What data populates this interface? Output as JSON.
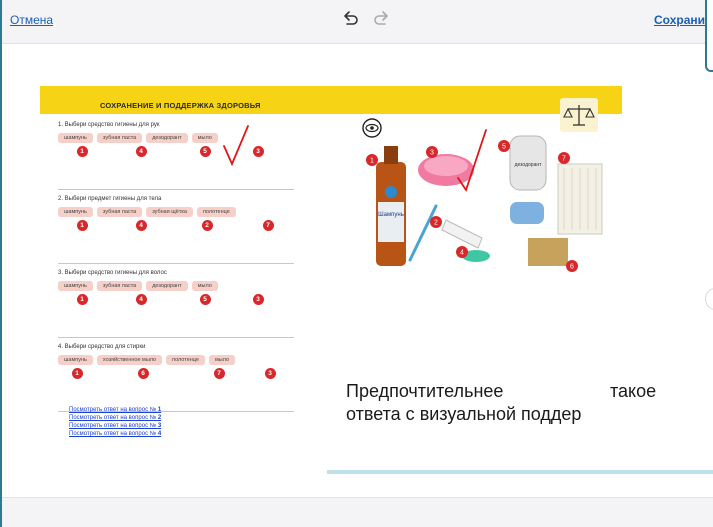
{
  "toolbar": {
    "cancel_label": "Отмена",
    "save_label": "Сохранить"
  },
  "slide": {
    "title": "СОХРАНЕНИЕ И ПОДДЕРЖКА ЗДОРОВЬЯ",
    "questions": [
      {
        "text": "1. Выбери средство гигиены для рук",
        "options": [
          "шампунь",
          "зубная паста",
          "дезодорант",
          "мыло"
        ],
        "numbers": [
          "1",
          "4",
          "5",
          "3"
        ]
      },
      {
        "text": "2. Выбери предмет гигиены для тела",
        "options": [
          "шампунь",
          "зубная паста",
          "зубная щётка",
          "полотенце"
        ],
        "numbers": [
          "1",
          "4",
          "2",
          "7"
        ]
      },
      {
        "text": "3. Выбери средство гигиены для волос",
        "options": [
          "шампунь",
          "зубная паста",
          "дезодорант",
          "мыло"
        ],
        "numbers": [
          "1",
          "4",
          "5",
          "3"
        ]
      },
      {
        "text": "4. Выбери средство для стирки",
        "options": [
          "шампунь",
          "хозяйственное мыло",
          "полотенце",
          "мыло"
        ],
        "numbers": [
          "1",
          "6",
          "7",
          "3"
        ]
      }
    ],
    "links": [
      {
        "prefix": "Посмотреть ответ на вопрос № ",
        "n": "1"
      },
      {
        "prefix": "Посмотреть ответ на вопрос № ",
        "n": "2"
      },
      {
        "prefix": "Посмотреть ответ на вопрос № ",
        "n": "3"
      },
      {
        "prefix": "Посмотреть ответ на вопрос № ",
        "n": "4"
      }
    ],
    "picture_labels": {
      "shampoo": "Шампунь",
      "deodorant": "дезодорант",
      "badges": [
        "1",
        "2",
        "3",
        "4",
        "5",
        "6",
        "7"
      ]
    }
  },
  "caption": {
    "line1_a": "Предпочтительнее",
    "line1_b": "такое",
    "line2": "ответа с визуальной поддер"
  },
  "colors": {
    "accent": "#2f7a93",
    "link": "#1a5fb4",
    "banner": "#f7d316",
    "chip": "#f6cfc8",
    "badge": "#d8282c"
  }
}
